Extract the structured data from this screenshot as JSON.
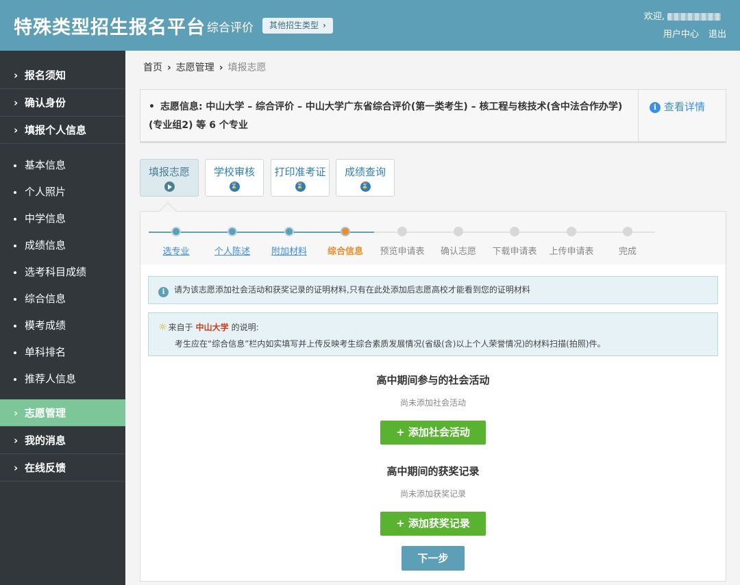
{
  "header": {
    "site_title": "特殊类型招生报名平台",
    "type": "综合评价",
    "other_type_button": "其他招生类型",
    "welcome": "欢迎,",
    "user_center": "用户中心",
    "logout": "退出"
  },
  "sidebar": {
    "items": [
      {
        "label": "报名须知"
      },
      {
        "label": "确认身份"
      },
      {
        "label": "填报个人信息"
      }
    ],
    "subitems": [
      {
        "label": "基本信息"
      },
      {
        "label": "个人照片"
      },
      {
        "label": "中学信息"
      },
      {
        "label": "成绩信息"
      },
      {
        "label": "选考科目成绩"
      },
      {
        "label": "综合信息"
      },
      {
        "label": "模考成绩"
      },
      {
        "label": "单科排名"
      },
      {
        "label": "推荐人信息"
      }
    ],
    "bottom_items": [
      {
        "label": "志愿管理",
        "active": true
      },
      {
        "label": "我的消息"
      },
      {
        "label": "在线反馈"
      }
    ]
  },
  "breadcrumb": {
    "home": "首页",
    "section": "志愿管理",
    "current": "填报志愿"
  },
  "info_box": {
    "text": "志愿信息: 中山大学 – 综合评价 – 中山大学广东省综合评价(第一类考生) – 核工程与核技术(含中法合作办学)(专业组2) 等 6 个专业",
    "detail_link": "查看详情"
  },
  "step_tabs": [
    {
      "label": "填报志愿",
      "icon": "play-icon",
      "active": true
    },
    {
      "label": "学校审核",
      "icon": "hourglass-icon"
    },
    {
      "label": "打印准考证",
      "icon": "hourglass-icon"
    },
    {
      "label": "成绩查询",
      "icon": "hourglass-icon"
    }
  ],
  "progress": {
    "steps": [
      {
        "label": "选专业",
        "state": "done"
      },
      {
        "label": "个人陈述",
        "state": "done"
      },
      {
        "label": "附加材料",
        "state": "done"
      },
      {
        "label": "综合信息",
        "state": "current"
      },
      {
        "label": "预览申请表",
        "state": "todo"
      },
      {
        "label": "确认志愿",
        "state": "todo"
      },
      {
        "label": "下载申请表",
        "state": "todo"
      },
      {
        "label": "上传申请表",
        "state": "todo"
      },
      {
        "label": "完成",
        "state": "todo"
      }
    ]
  },
  "notice": {
    "text": "请为该志愿添加社会活动和获奖记录的证明材料,只有在此处添加后志愿高校才能看到您的证明材料"
  },
  "notice2": {
    "prefix": "来自于",
    "university": "中山大学",
    "suffix": "的说明:",
    "body": "考生应在“综合信息”栏内如实填写并上传反映考生综合素质发展情况(省级(含)以上个人荣誉情况)的材料扫描(拍照)件。"
  },
  "social": {
    "title": "高中期间参与的社会活动",
    "empty": "尚未添加社会活动",
    "button": "+ 添加社会活动"
  },
  "awards": {
    "title": "高中期间的获奖记录",
    "empty": "尚未添加获奖记录",
    "button": "+ 添加获奖记录"
  },
  "next_button": "下一步",
  "colors": {
    "header_bg": "#5d9fb6",
    "sidebar_bg": "#31373b",
    "sidebar_active": "#7dc69a",
    "accent_green": "#5ab231",
    "current_step": "#f08a24",
    "link_blue": "#3a8ee6"
  }
}
